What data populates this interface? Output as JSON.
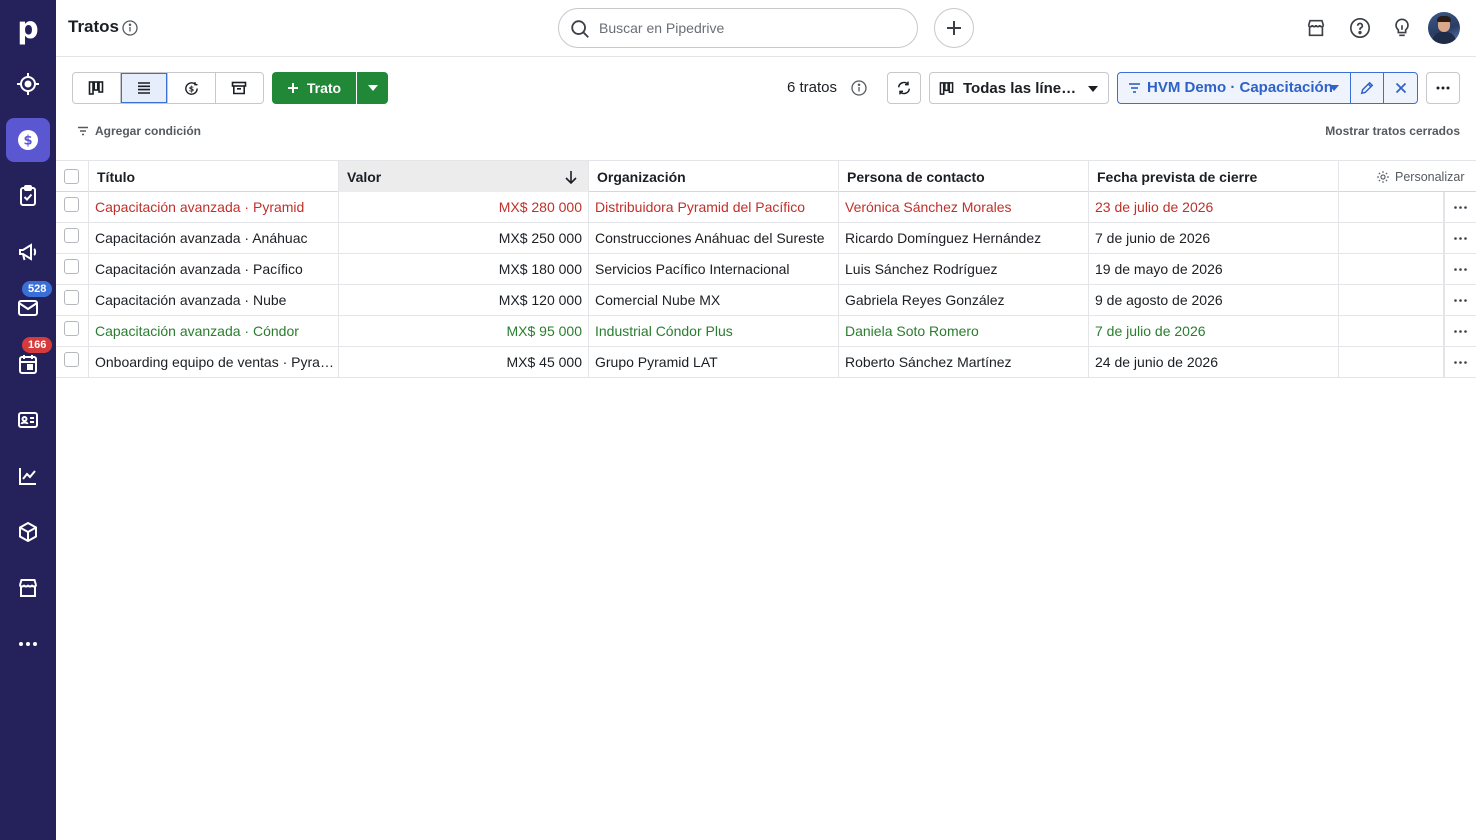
{
  "sidebar": {
    "logo": "p",
    "items": [
      {
        "name": "leads",
        "icon": "target-icon"
      },
      {
        "name": "deals",
        "icon": "dollar-icon",
        "active": true
      },
      {
        "name": "activities",
        "icon": "clipboard-check-icon"
      },
      {
        "name": "campaigns",
        "icon": "megaphone-icon"
      },
      {
        "name": "mail",
        "icon": "mail-icon",
        "badge": "528"
      },
      {
        "name": "calendar",
        "icon": "calendar-icon",
        "badge": "166"
      },
      {
        "name": "contacts",
        "icon": "contact-card-icon"
      },
      {
        "name": "insights",
        "icon": "chart-line-icon"
      },
      {
        "name": "products",
        "icon": "box-icon"
      },
      {
        "name": "marketplace",
        "icon": "store-icon"
      },
      {
        "name": "more",
        "icon": "more-horizontal-icon"
      }
    ],
    "badges": {
      "mail": "528",
      "calendar": "166"
    }
  },
  "header": {
    "title": "Tratos",
    "search_placeholder": "Buscar en Pipedrive"
  },
  "toolbar": {
    "add_deal_label": "Trato",
    "deal_count": "6 tratos",
    "pipeline": "Todas las líneas de embudo",
    "filter": "HVM Demo · Capacitación",
    "add_condition": "Agregar condición",
    "show_closed": "Mostrar tratos cerrados"
  },
  "table": {
    "columns": [
      "Título",
      "Valor",
      "Organización",
      "Persona de contacto",
      "Fecha prevista de cierre"
    ],
    "personalize": "Personalizar",
    "rows": [
      {
        "title": "Capacitación avanzada · Pyramid",
        "value": "MX$ 280 000",
        "org": "Distribuidora Pyramid del Pacífico",
        "person": "Verónica Sánchez Morales",
        "date": "23 de julio de 2026",
        "status": "red"
      },
      {
        "title": "Capacitación avanzada · Anáhuac",
        "value": "MX$ 250 000",
        "org": "Construcciones Anáhuac del Sureste",
        "person": "Ricardo Domínguez Hernández",
        "date": "7 de junio de 2026",
        "status": "normal"
      },
      {
        "title": "Capacitación avanzada · Pacífico",
        "value": "MX$ 180 000",
        "org": "Servicios Pacífico Internacional",
        "person": "Luis Sánchez Rodríguez",
        "date": "19 de mayo de 2026",
        "status": "normal"
      },
      {
        "title": "Capacitación avanzada · Nube",
        "value": "MX$ 120 000",
        "org": "Comercial Nube MX",
        "person": "Gabriela Reyes González",
        "date": "9 de agosto de 2026",
        "status": "normal"
      },
      {
        "title": "Capacitación avanzada · Cóndor",
        "value": "MX$ 95 000",
        "org": "Industrial Cóndor Plus",
        "person": "Daniela Soto Romero",
        "date": "7 de julio de 2026",
        "status": "green"
      },
      {
        "title": "Onboarding equipo de ventas · Pyramid",
        "value": "MX$ 45 000",
        "org": "Grupo Pyramid LAT",
        "person": "Roberto Sánchez Martínez",
        "date": "24 de junio de 2026",
        "status": "normal"
      }
    ]
  },
  "colors": {
    "sidebar": "#24215b",
    "active": "#5b57d1",
    "primary_green": "#218838",
    "filter_blue": "#2f62c8",
    "overdue_red": "#c0302b",
    "future_green": "#2a7d2f"
  }
}
